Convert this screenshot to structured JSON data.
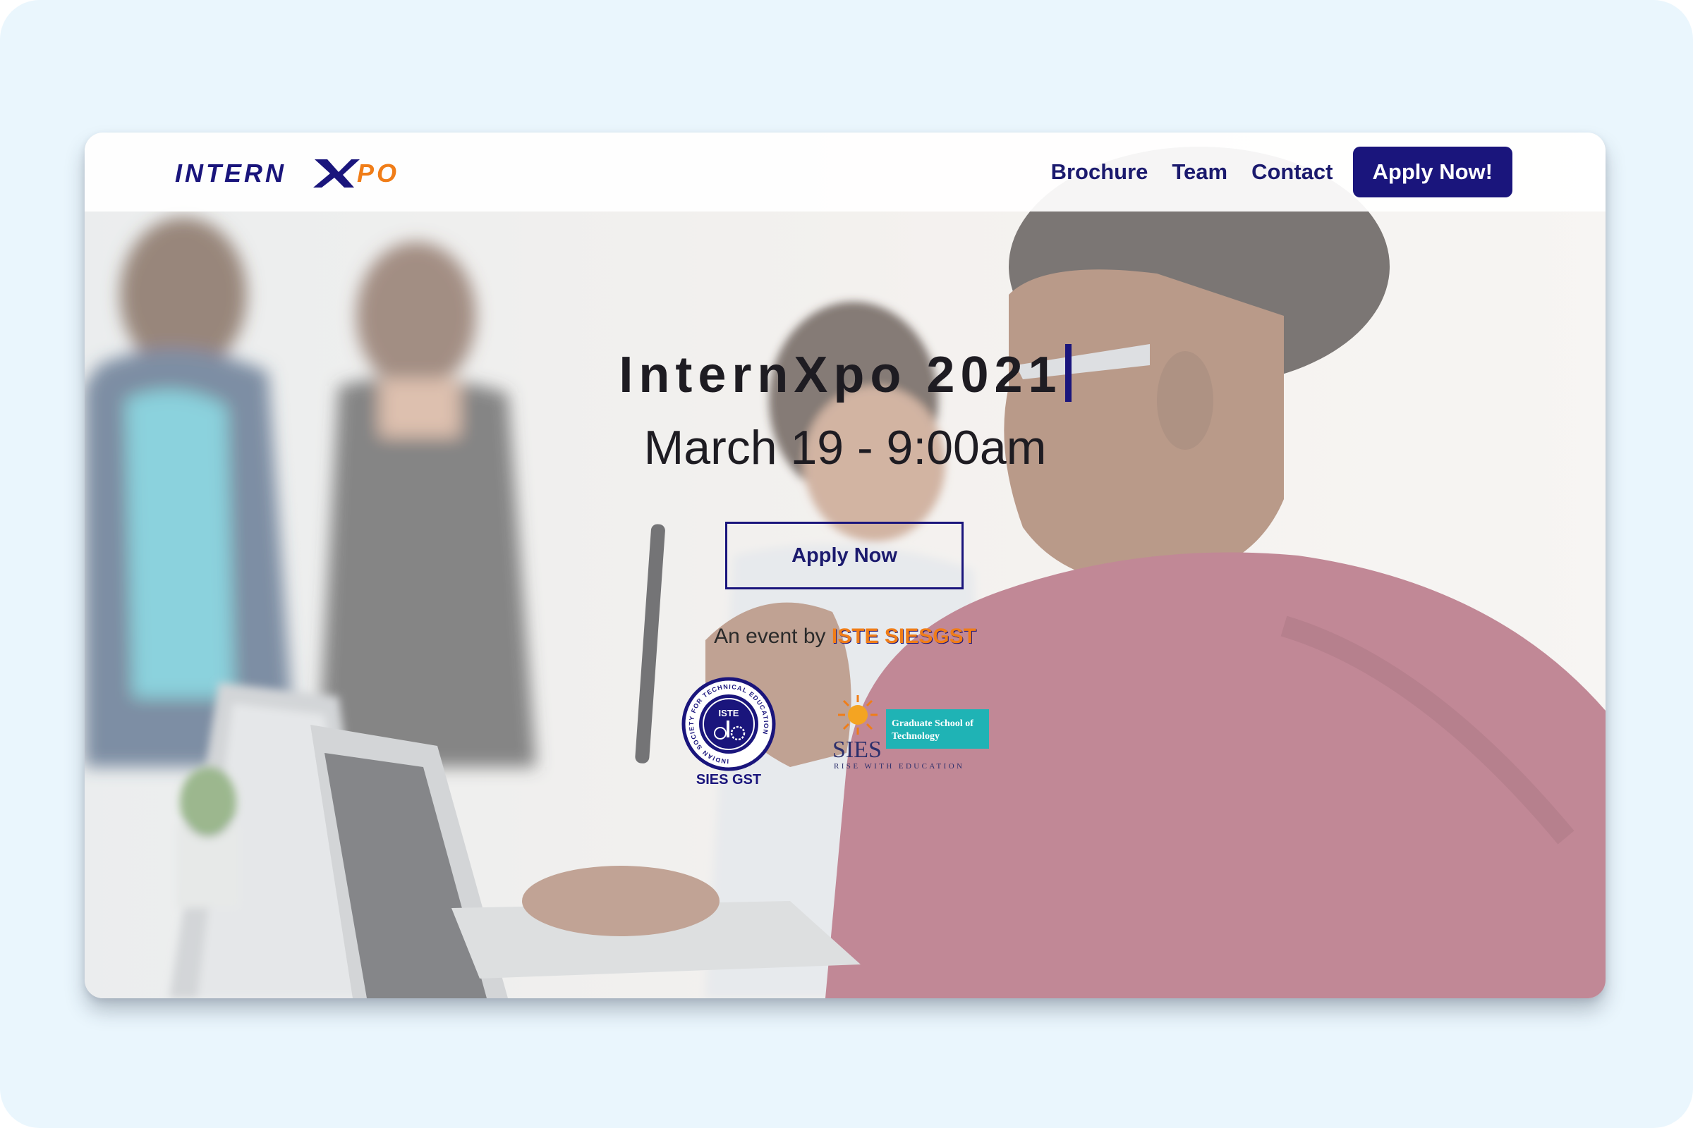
{
  "brand": {
    "logo_text": "INTERNXPO",
    "logo_prefix": "INTERN",
    "logo_suffix": "PO",
    "colors": {
      "navy": "#1a157c",
      "orange": "#f07d18"
    }
  },
  "nav": {
    "links": [
      "Brochure",
      "Team",
      "Contact"
    ],
    "cta": "Apply Now!"
  },
  "hero": {
    "title": "InternXpo 2021",
    "date": "March 19 - 9:00am",
    "apply_label": "Apply Now",
    "event_prefix": "An event by",
    "event_org": "ISTE SIESGST"
  },
  "logos": {
    "iste_center": "ISTE",
    "iste_ring": "INDIAN SOCIETY FOR TECHNICAL EDUCATION",
    "iste_caption": "SIES GST",
    "sies_name": "SIES",
    "sies_tagline": "RISE WITH EDUCATION",
    "sies_box_line1": "Graduate School of",
    "sies_box_line2": "Technology"
  }
}
